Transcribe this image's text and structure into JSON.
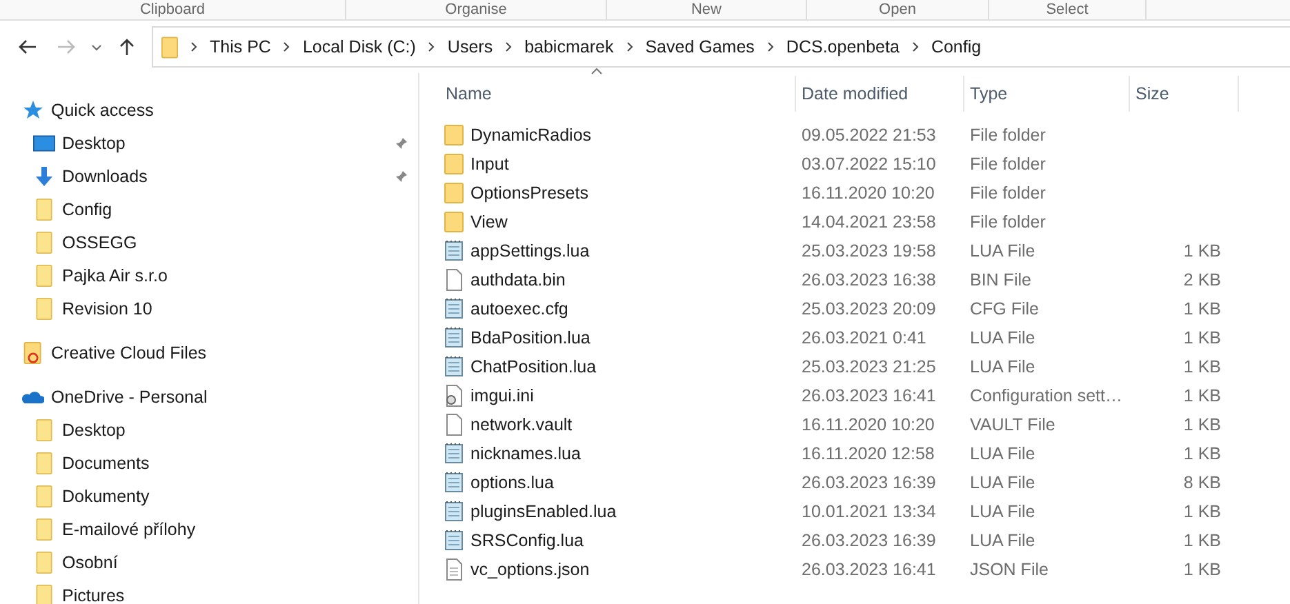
{
  "ribbon_groups": [
    "Clipboard",
    "Organise",
    "New",
    "Open",
    "Select"
  ],
  "address_bar": {
    "crumbs": [
      "This PC",
      "Local Disk (C:)",
      "Users",
      "babicmarek",
      "Saved Games",
      "DCS.openbeta",
      "Config"
    ]
  },
  "navigation": [
    {
      "label": "Quick access",
      "kind": "quick",
      "pinned": false,
      "children": [
        {
          "label": "Desktop",
          "kind": "desktop",
          "pinned": true
        },
        {
          "label": "Downloads",
          "kind": "download",
          "pinned": true
        },
        {
          "label": "Config",
          "kind": "folder",
          "pinned": false
        },
        {
          "label": "OSSEGG",
          "kind": "folder",
          "pinned": false
        },
        {
          "label": "Pajka Air s.r.o",
          "kind": "folder",
          "pinned": false
        },
        {
          "label": "Revision 10",
          "kind": "folder",
          "pinned": false
        }
      ]
    },
    {
      "label": "Creative Cloud Files",
      "kind": "cloudfiles",
      "pinned": false
    },
    {
      "label": "OneDrive - Personal",
      "kind": "onedrive",
      "pinned": false,
      "children": [
        {
          "label": "Desktop",
          "kind": "folder",
          "pinned": false
        },
        {
          "label": "Documents",
          "kind": "folder",
          "pinned": false
        },
        {
          "label": "Dokumenty",
          "kind": "folder",
          "pinned": false
        },
        {
          "label": "E-mailové přílohy",
          "kind": "folder",
          "pinned": false
        },
        {
          "label": "Osobní",
          "kind": "folder",
          "pinned": false
        },
        {
          "label": "Pictures",
          "kind": "folder",
          "pinned": false
        }
      ]
    }
  ],
  "table": {
    "columns": [
      "Name",
      "Date modified",
      "Type",
      "Size"
    ],
    "rows": [
      {
        "name": "DynamicRadios",
        "date": "09.05.2022 21:53",
        "type": "File folder",
        "kind": "folder"
      },
      {
        "name": "Input",
        "date": "03.07.2022 15:10",
        "type": "File folder",
        "kind": "folder"
      },
      {
        "name": "OptionsPresets",
        "date": "16.11.2020 10:20",
        "type": "File folder",
        "kind": "folder"
      },
      {
        "name": "View",
        "date": "14.04.2021 23:58",
        "type": "File folder",
        "kind": "folder"
      },
      {
        "name": "appSettings.lua",
        "date": "25.03.2023 19:58",
        "type": "LUA File",
        "size": "1 KB",
        "kind": "text"
      },
      {
        "name": "authdata.bin",
        "date": "26.03.2023 16:38",
        "type": "BIN File",
        "size": "2 KB",
        "kind": "blank"
      },
      {
        "name": "autoexec.cfg",
        "date": "25.03.2023 20:09",
        "type": "CFG File",
        "size": "1 KB",
        "kind": "text"
      },
      {
        "name": "BdaPosition.lua",
        "date": "26.03.2021 0:41",
        "type": "LUA File",
        "size": "1 KB",
        "kind": "text"
      },
      {
        "name": "ChatPosition.lua",
        "date": "25.03.2023 21:25",
        "type": "LUA File",
        "size": "1 KB",
        "kind": "text"
      },
      {
        "name": "imgui.ini",
        "date": "26.03.2023 16:41",
        "type": "Configuration sett…",
        "size": "1 KB",
        "kind": "settings"
      },
      {
        "name": "network.vault",
        "date": "16.11.2020 10:20",
        "type": "VAULT File",
        "size": "1 KB",
        "kind": "blank"
      },
      {
        "name": "nicknames.lua",
        "date": "16.11.2020 12:58",
        "type": "LUA File",
        "size": "1 KB",
        "kind": "text"
      },
      {
        "name": "options.lua",
        "date": "26.03.2023 16:39",
        "type": "LUA File",
        "size": "8 KB",
        "kind": "text"
      },
      {
        "name": "pluginsEnabled.lua",
        "date": "10.01.2021 13:34",
        "type": "LUA File",
        "size": "1 KB",
        "kind": "text"
      },
      {
        "name": "SRSConfig.lua",
        "date": "26.03.2023 16:39",
        "type": "LUA File",
        "size": "1 KB",
        "kind": "text"
      },
      {
        "name": "vc_options.json",
        "date": "26.03.2023 16:41",
        "type": "JSON File",
        "size": "1 KB",
        "kind": "lined"
      }
    ]
  }
}
